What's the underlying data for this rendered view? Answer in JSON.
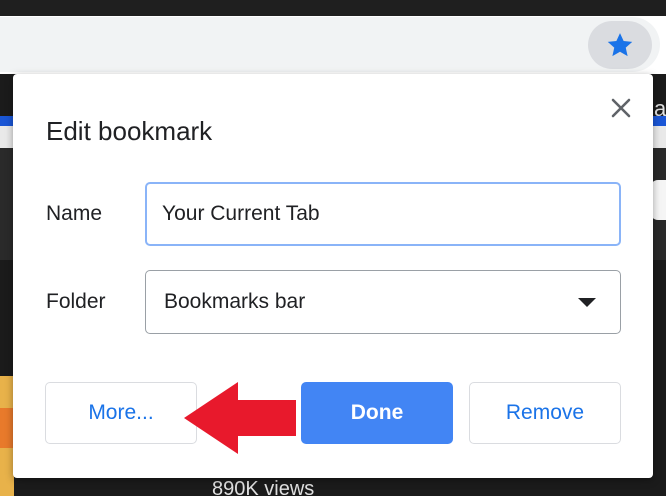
{
  "browser": {
    "bookmark_star_icon": "star-icon",
    "accent": "#1a73e8",
    "background_text": "890K views",
    "right_edge_text": "a"
  },
  "dialog": {
    "title": "Edit bookmark",
    "close_icon": "close-icon",
    "name_label": "Name",
    "name_value": "Your Current Tab",
    "folder_label": "Folder",
    "folder_value": "Bookmarks bar",
    "buttons": {
      "more": "More...",
      "done": "Done",
      "remove": "Remove"
    },
    "annotation_arrow_color": "#e8192c"
  }
}
